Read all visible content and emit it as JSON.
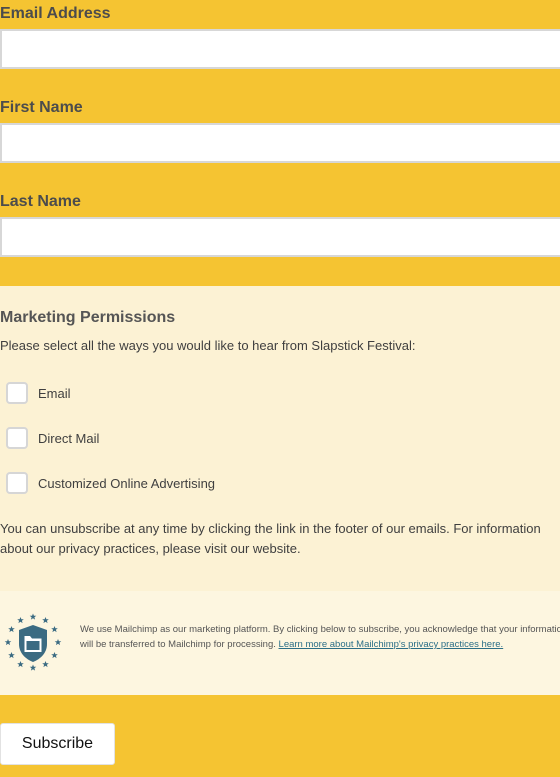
{
  "fields": [
    {
      "label": "Email Address",
      "value": "",
      "placeholder": ""
    },
    {
      "label": "First Name",
      "value": "",
      "placeholder": ""
    },
    {
      "label": "Last Name",
      "value": "",
      "placeholder": ""
    }
  ],
  "permissions": {
    "title": "Marketing Permissions",
    "description": "Please select all the ways you would like to hear from Slapstick Festival:",
    "options": [
      {
        "label": "Email",
        "checked": false
      },
      {
        "label": "Direct Mail",
        "checked": false
      },
      {
        "label": "Customized Online Advertising",
        "checked": false
      }
    ],
    "note": "You can unsubscribe at any time by clicking the link in the footer of our emails. For information about our privacy practices, please visit our website."
  },
  "legal": {
    "logo_icon": "gdpr-shield-folder-icon",
    "text": "We use Mailchimp as our marketing platform. By clicking below to subscribe, you acknowledge that your information will be transferred to Mailchimp for processing.",
    "link_text": "Learn more about Mailchimp's privacy practices here."
  },
  "submit": {
    "label": "Subscribe"
  },
  "colors": {
    "background": "#f5c432",
    "permissions_bg": "#fcf2d4",
    "legal_bg": "#fdf6e0",
    "link": "#2c6f87",
    "logo": "#3b6b82"
  }
}
